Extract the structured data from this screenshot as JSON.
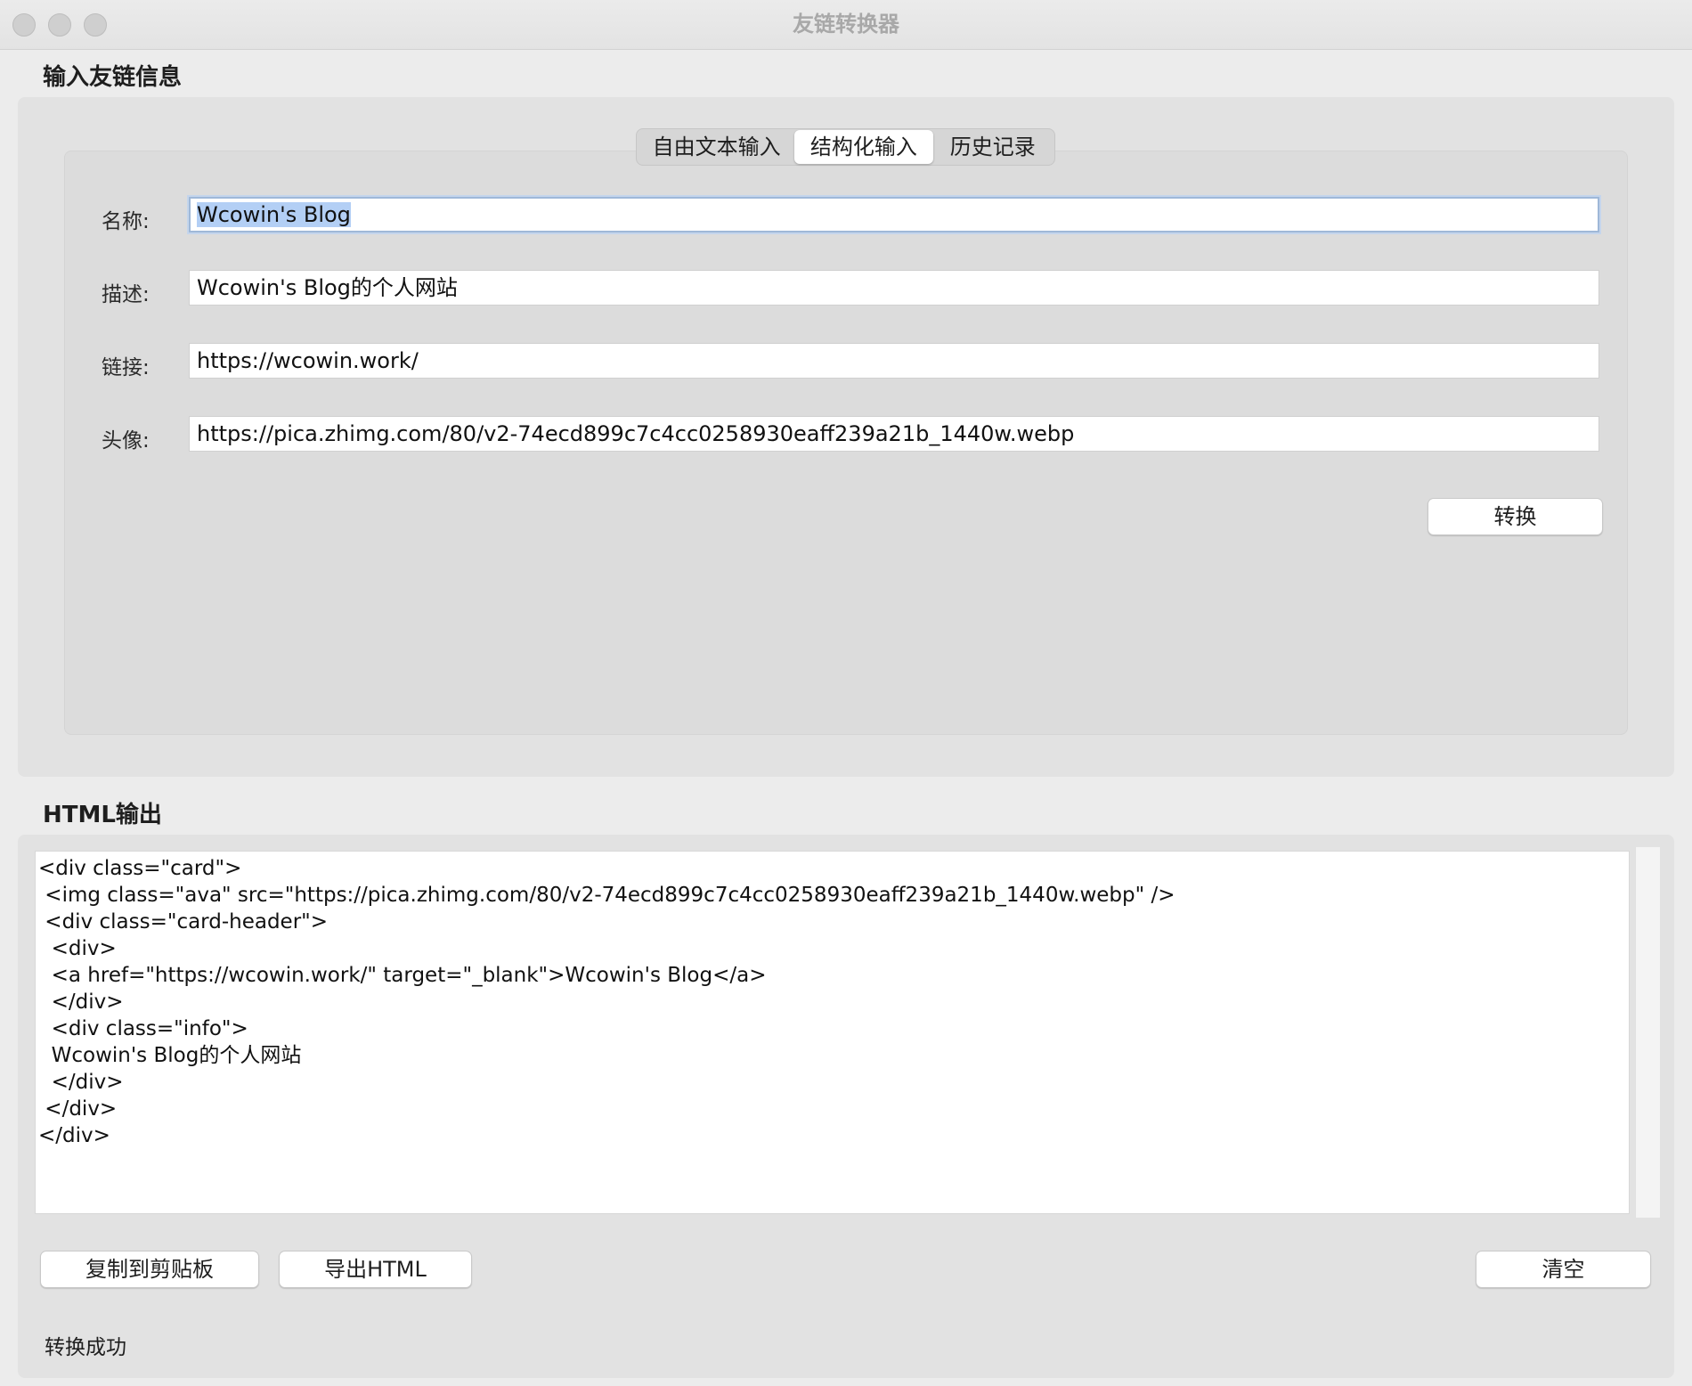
{
  "window": {
    "title": "友链转换器"
  },
  "input_section": {
    "title": "输入友链信息",
    "tabs": [
      {
        "label": "自由文本输入",
        "selected": false
      },
      {
        "label": "结构化输入",
        "selected": true
      },
      {
        "label": "历史记录",
        "selected": false
      }
    ],
    "fields": {
      "name": {
        "label": "名称:",
        "value": "Wcowin's Blog"
      },
      "description": {
        "label": "描述:",
        "value": "Wcowin's Blog的个人网站"
      },
      "link": {
        "label": "链接:",
        "value": "https://wcowin.work/"
      },
      "avatar": {
        "label": "头像:",
        "value": "https://pica.zhimg.com/80/v2-74ecd899c7c4cc0258930eaff239a21b_1440w.webp"
      }
    },
    "convert_label": "转换"
  },
  "output_section": {
    "title": "HTML输出",
    "code": "<div class=\"card\">\n <img class=\"ava\" src=\"https://pica.zhimg.com/80/v2-74ecd899c7c4cc0258930eaff239a21b_1440w.webp\" />\n <div class=\"card-header\">\n  <div>\n  <a href=\"https://wcowin.work/\" target=\"_blank\">Wcowin's Blog</a>\n  </div>\n  <div class=\"info\">\n  Wcowin's Blog的个人网站\n  </div>\n </div>\n</div>",
    "copy_label": "复制到剪贴板",
    "export_label": "导出HTML",
    "clear_label": "清空",
    "status": "转换成功"
  }
}
